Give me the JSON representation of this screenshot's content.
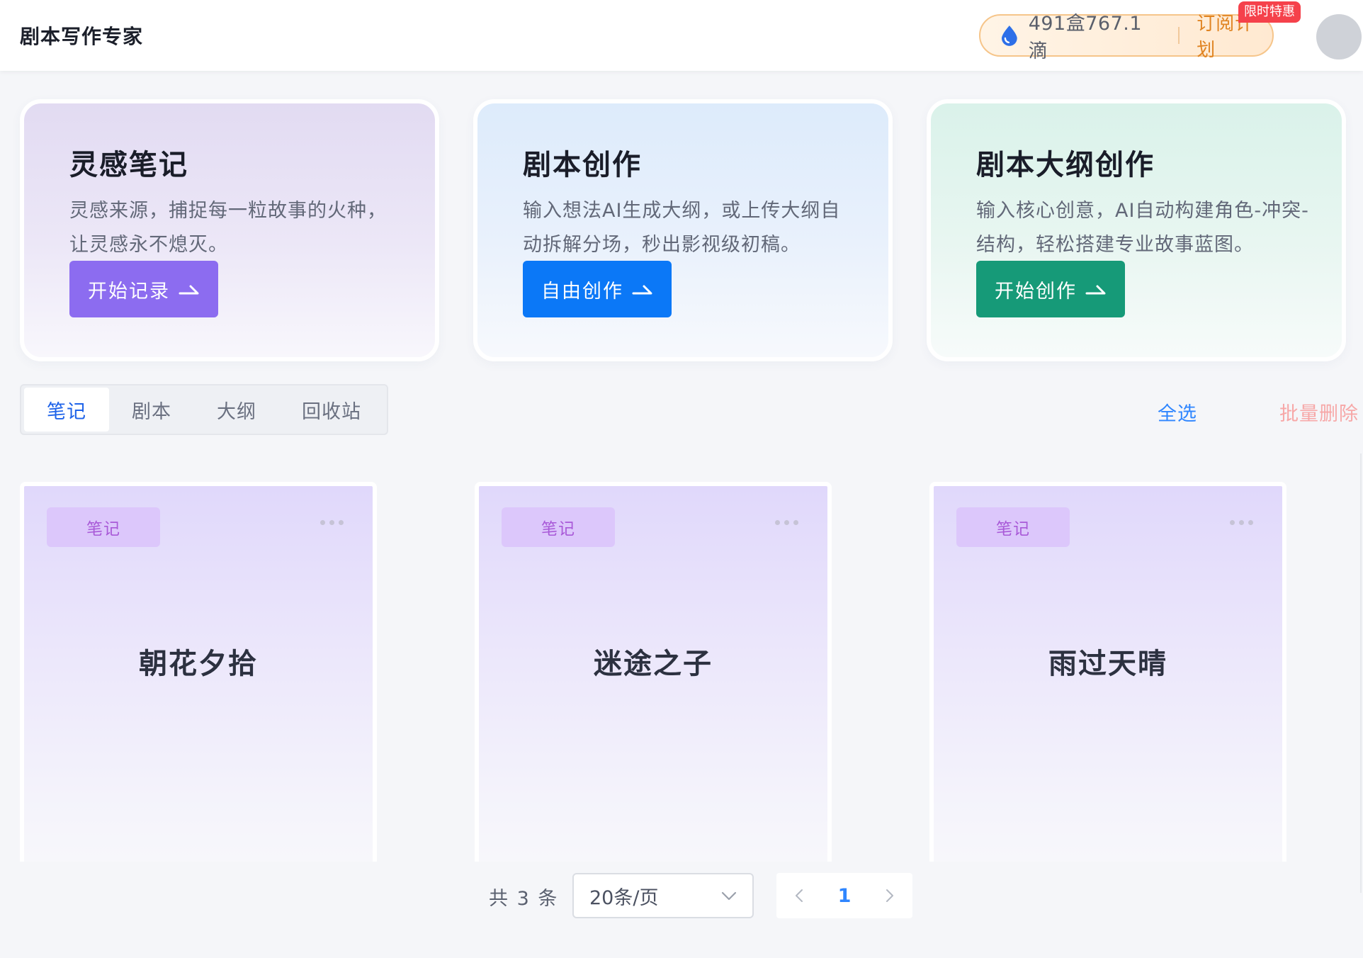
{
  "header": {
    "app_title": "剧本写作专家",
    "credit_text": "491盒767.1滴",
    "subscribe_label": "订阅计划",
    "promo_badge": "限时特惠"
  },
  "feature_cards": [
    {
      "title": "灵感笔记",
      "description": "灵感来源，捕捉每一粒故事的火种，让灵感永不熄灭。",
      "button_label": "开始记录"
    },
    {
      "title": "剧本创作",
      "description": "输入想法AI生成大纲，或上传大纲自动拆解分场，秒出影视级初稿。",
      "button_label": "自由创作"
    },
    {
      "title": "剧本大纲创作",
      "description": "输入核心创意，AI自动构建角色-冲突-结构，轻松搭建专业故事蓝图。",
      "button_label": "开始创作"
    }
  ],
  "tabs": [
    {
      "label": "笔记",
      "active": true
    },
    {
      "label": "剧本",
      "active": false
    },
    {
      "label": "大纲",
      "active": false
    },
    {
      "label": "回收站",
      "active": false
    }
  ],
  "toolbar": {
    "select_all": "全选",
    "batch_delete": "批量删除"
  },
  "notes": [
    {
      "tag": "笔记",
      "title": "朝花夕拾"
    },
    {
      "tag": "笔记",
      "title": "迷途之子"
    },
    {
      "tag": "笔记",
      "title": "雨过天晴"
    }
  ],
  "pagination": {
    "total_text": "共 3 条",
    "page_size": "20条/页",
    "current_page": "1"
  },
  "colors": {
    "primary_blue": "#0b78f7",
    "purple": "#8c6cf0",
    "green": "#169a78",
    "promo_red": "#f5414b",
    "subscribe_orange": "#e08422",
    "danger_light": "#f7a7a7"
  },
  "icons": [
    "water-drop-icon",
    "arrow-right-icon",
    "more-dots-icon",
    "chevron-down-icon",
    "chevron-left-icon",
    "chevron-right-icon"
  ]
}
